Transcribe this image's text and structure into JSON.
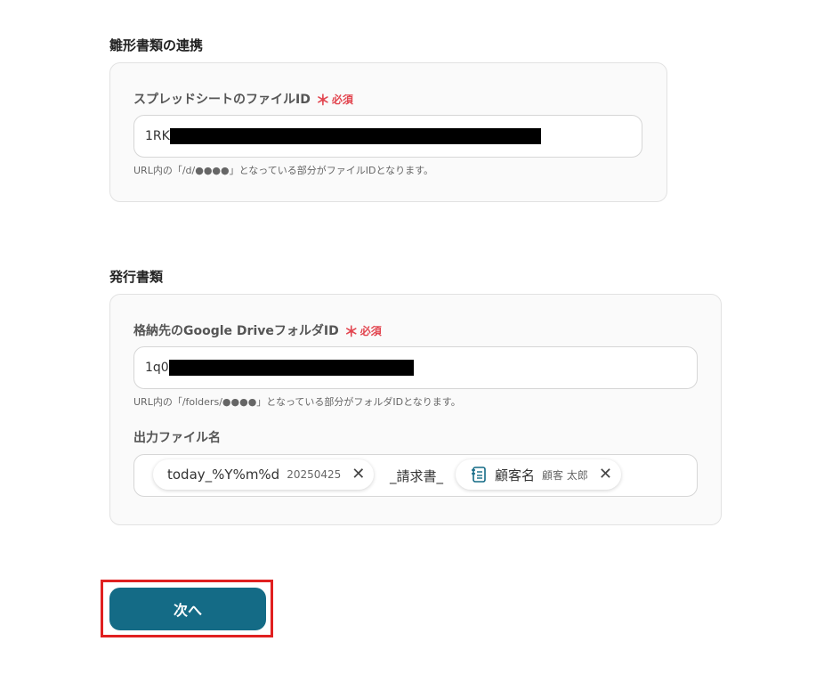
{
  "template_section": {
    "title": "雛形書類の連携",
    "file_id_label": "スプレッドシートのファイルID",
    "required_mark": "＊",
    "required_text": "必須",
    "file_id_value": "1RK",
    "file_id_hint": "URL内の「/d/●●●●」となっている部分がファイルIDとなります。"
  },
  "issue_section": {
    "title": "発行書類",
    "folder_id_label": "格納先のGoogle DriveフォルダID",
    "required_mark": "＊",
    "required_text": "必須",
    "folder_id_value": "1q0",
    "folder_id_hint": "URL内の「/folders/●●●●」となっている部分がフォルダIDとなります。",
    "output_name_label": "出力ファイル名",
    "output_tokens": {
      "date_chip_label": "today_%Y%m%d",
      "date_chip_value": "20250425",
      "separator_text": "_請求書_",
      "customer_chip_label": "顧客名",
      "customer_chip_value": "顧客 太郎",
      "remove_symbol": "✕"
    }
  },
  "actions": {
    "next_label": "次へ"
  },
  "icons": {
    "customer_chip_icon": "document-list-icon",
    "remove_icon": "close-icon"
  },
  "colors": {
    "primary_button": "#146b86",
    "required": "#e2454f",
    "highlight": "#e02020"
  }
}
